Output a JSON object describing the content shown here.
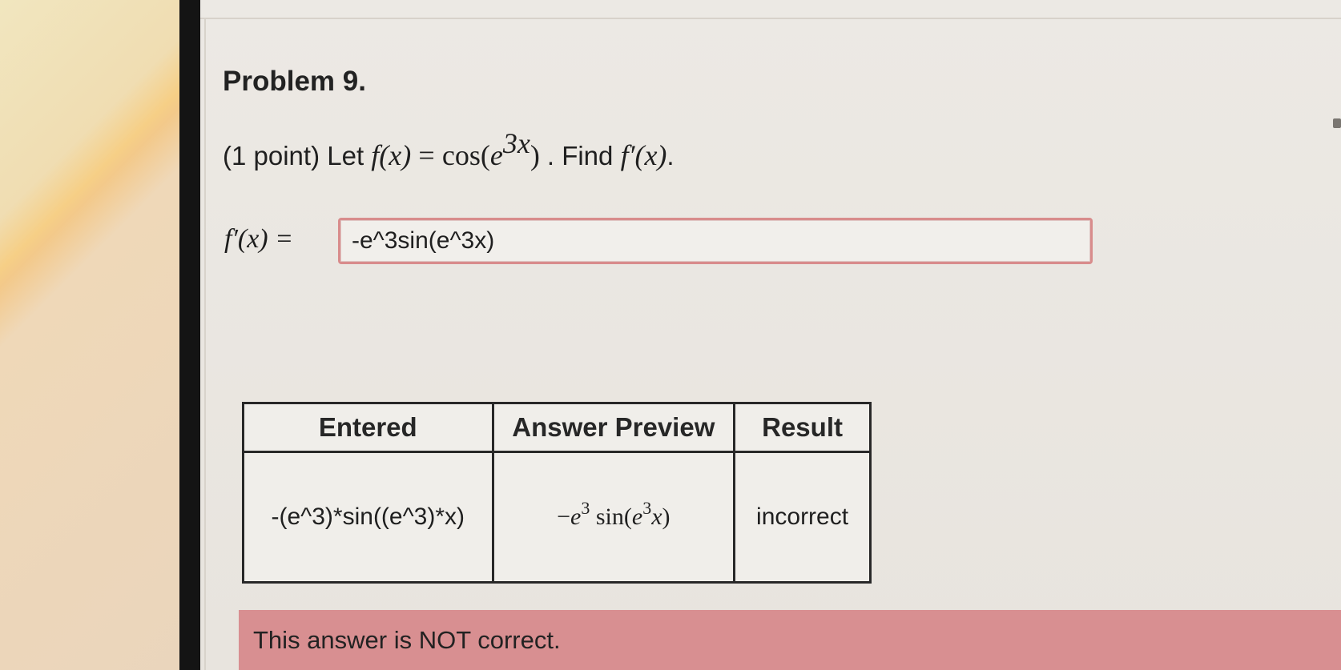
{
  "problem": {
    "title": "Problem 9.",
    "points": "(1 point)",
    "let_word": "Let",
    "f_of_x": "f(x)",
    "equals": "=",
    "cos_text": "cos(",
    "base_e": "e",
    "exponent": "3x",
    "close_paren": ")",
    "find_text": ". Find",
    "derivative_expr": "f′(x)",
    "period": "."
  },
  "answer": {
    "label": "f′(x) =",
    "value": "-e^3sin(e^3x)"
  },
  "results_table": {
    "headers": [
      "Entered",
      "Answer Preview",
      "Result"
    ],
    "rows": [
      {
        "entered": "-(e^3)*sin((e^3)*x)",
        "preview_minus": "−",
        "preview_base": "e",
        "preview_exp": "3",
        "preview_sin": "sin",
        "preview_open": "(",
        "preview_base2": "e",
        "preview_exp2": "3",
        "preview_x": "x",
        "preview_close": ")",
        "result": "incorrect"
      }
    ]
  },
  "notice": {
    "message": "This answer is NOT correct."
  },
  "colors": {
    "incorrect_banner": "#d88f91",
    "input_border": "#d88c8c"
  }
}
